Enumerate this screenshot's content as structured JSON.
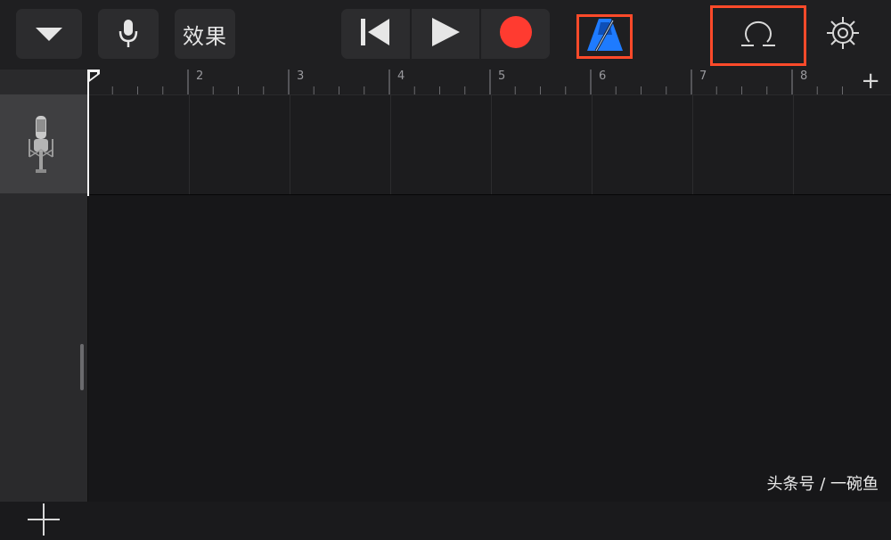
{
  "toolbar": {
    "effects_label": "效果",
    "bar_icons": [
      "chevron-down-icon",
      "microphone-icon",
      "skip-back-icon",
      "play-icon",
      "record-icon",
      "metronome-icon",
      "loop-icon",
      "gear-icon"
    ],
    "record_color": "#ff3b30",
    "metronome_color": "#1e7bff",
    "highlight_color": "#ff4a2a"
  },
  "ruler": {
    "bar_numbers": [
      "2",
      "3",
      "4",
      "5",
      "6",
      "7",
      "8"
    ],
    "add_label": "+"
  },
  "tracks": [
    {
      "instrument": "microphone-icon"
    }
  ],
  "sidebar": {
    "add_track_label": "+"
  },
  "watermark": "头条号 / 一碗鱼"
}
